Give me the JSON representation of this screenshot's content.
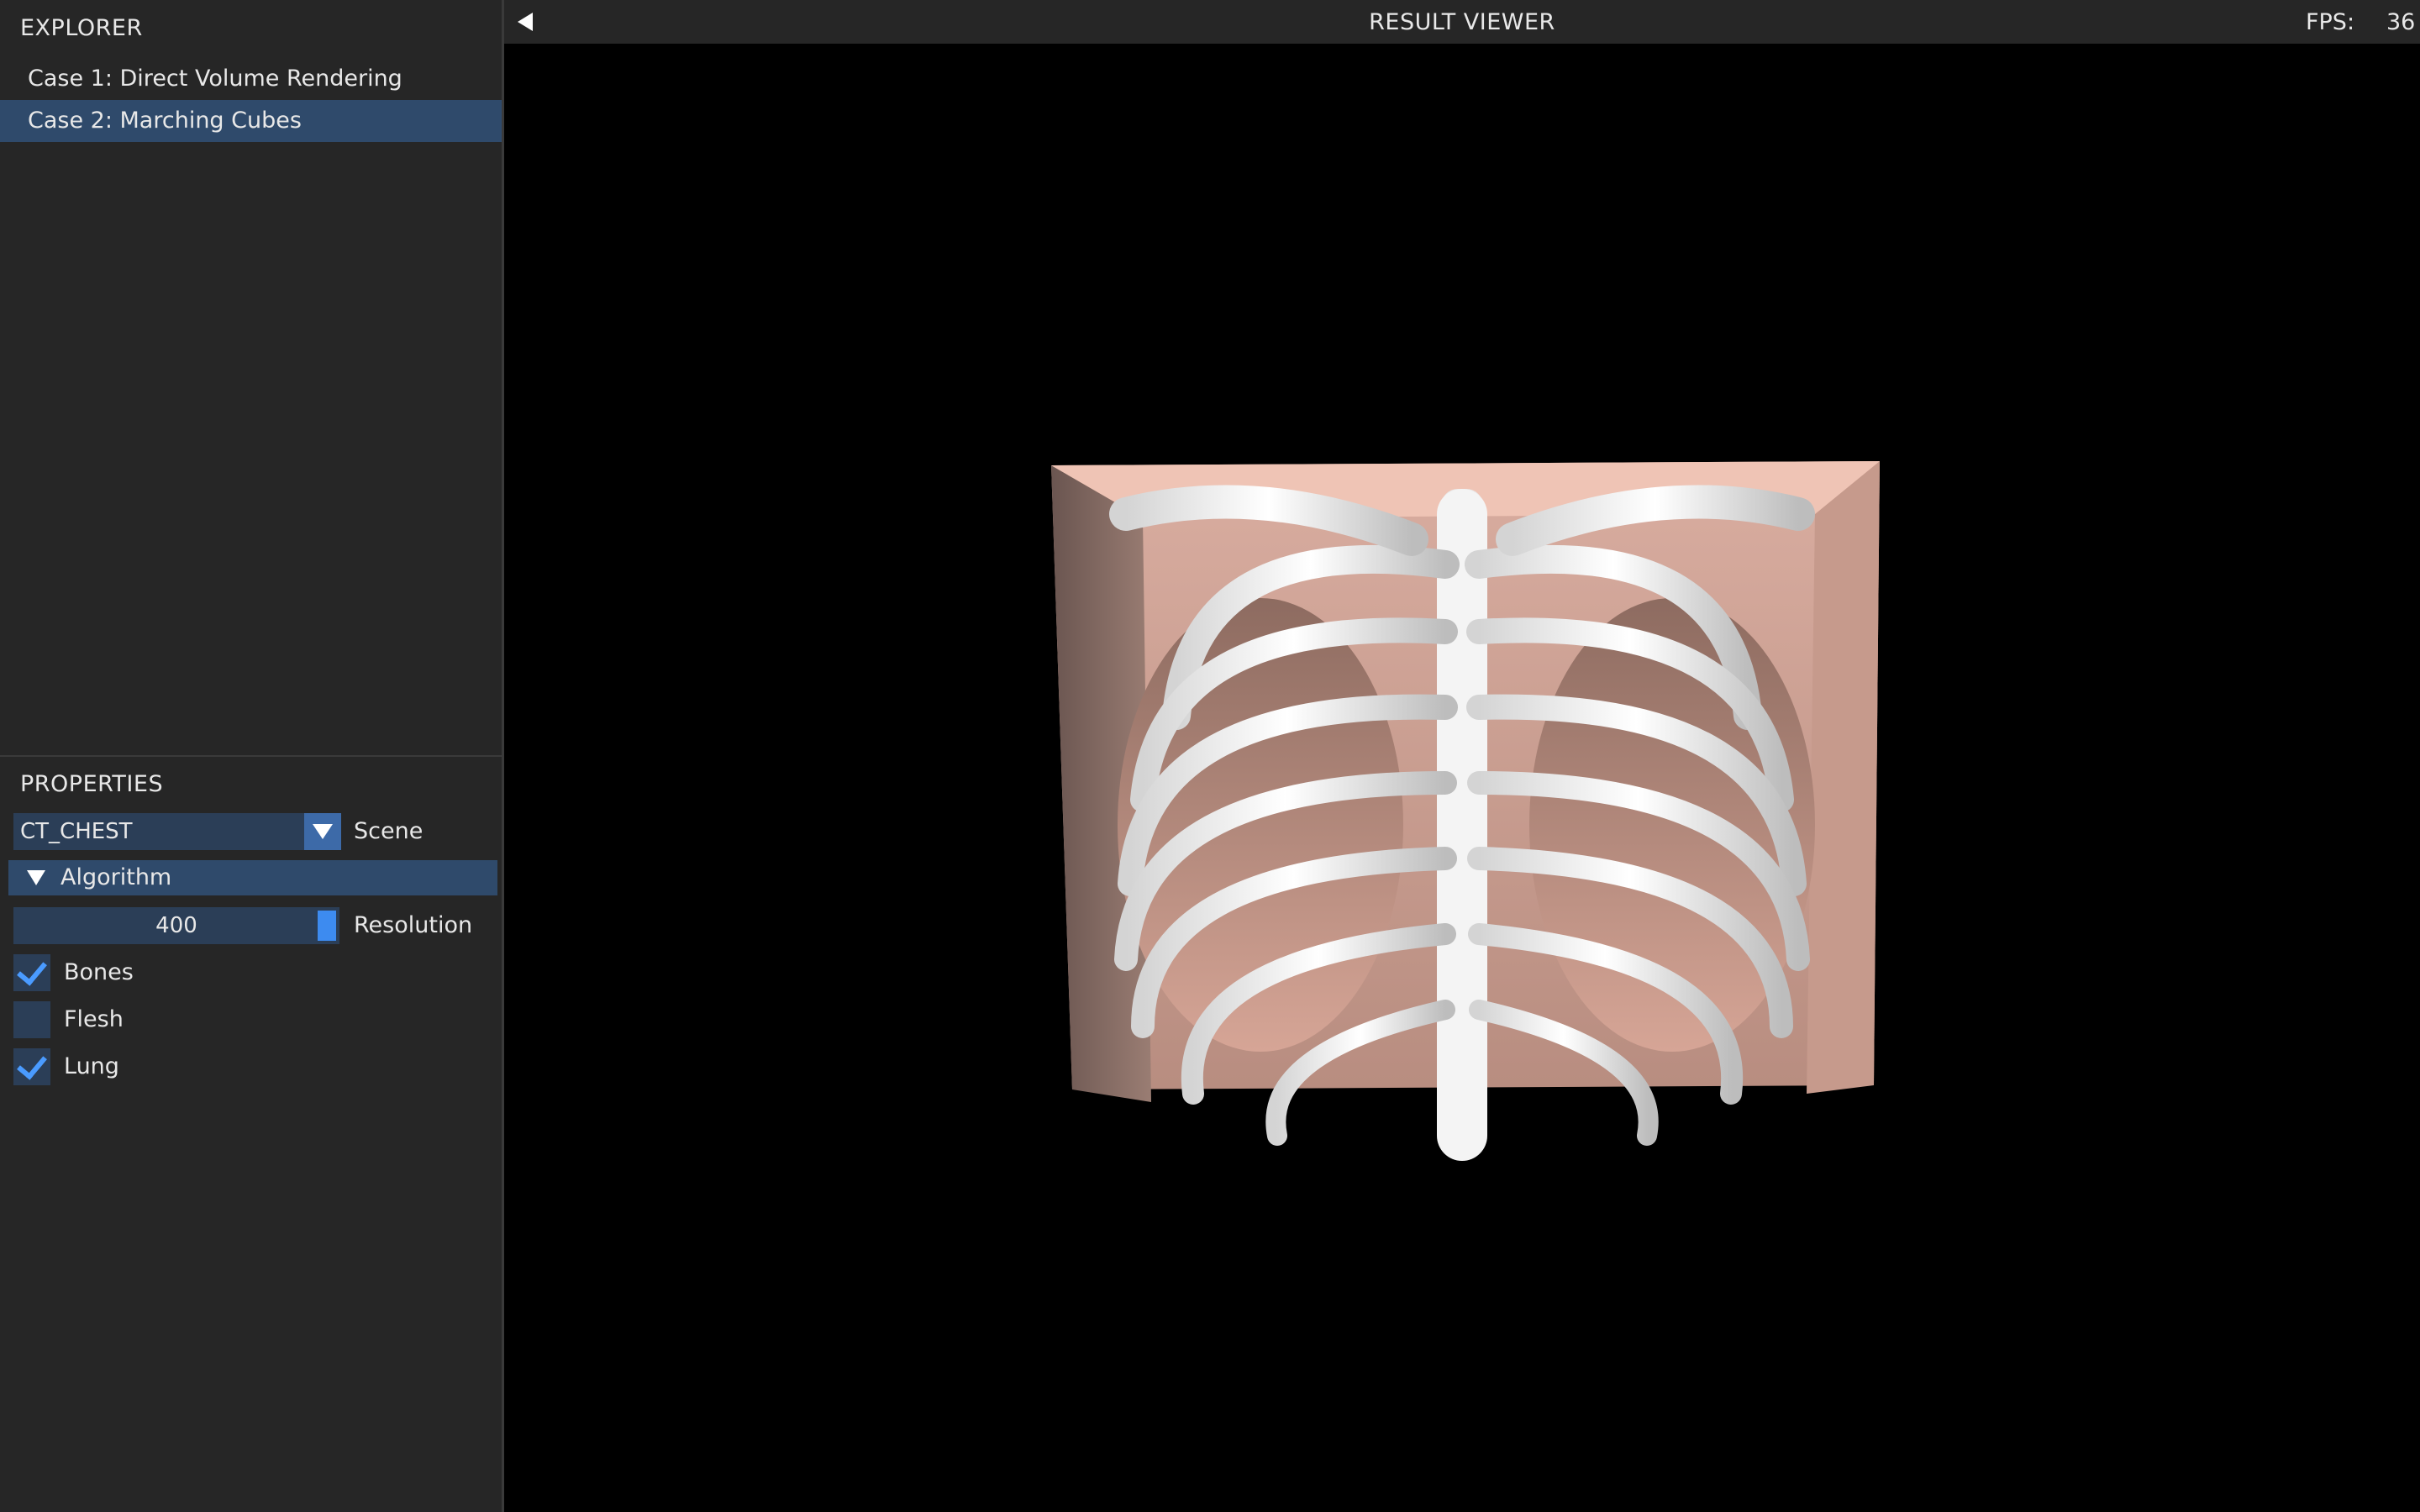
{
  "explorer": {
    "title": "EXPLORER",
    "cases": [
      {
        "label": "Case 1: Direct Volume Rendering",
        "selected": false
      },
      {
        "label": "Case 2: Marching Cubes",
        "selected": true
      }
    ]
  },
  "properties": {
    "title": "PROPERTIES",
    "scene": {
      "value": "CT_CHEST",
      "label": "Scene"
    },
    "algorithm": {
      "label": "Algorithm",
      "expanded": true
    },
    "resolution": {
      "value": "400",
      "label": "Resolution"
    },
    "toggles": [
      {
        "label": "Bones",
        "checked": true
      },
      {
        "label": "Flesh",
        "checked": false
      },
      {
        "label": "Lung",
        "checked": true
      }
    ]
  },
  "viewer": {
    "title": "RESULT VIEWER",
    "fps_label": "FPS:",
    "fps_value": "36"
  },
  "colors": {
    "panel_bg": "#262626",
    "selected_bg": "#2f4a6b",
    "widget_bg": "#2b3e57",
    "accent": "#3d8bf0",
    "flesh": "#e8b6a4",
    "bone": "#f2f2f2"
  }
}
